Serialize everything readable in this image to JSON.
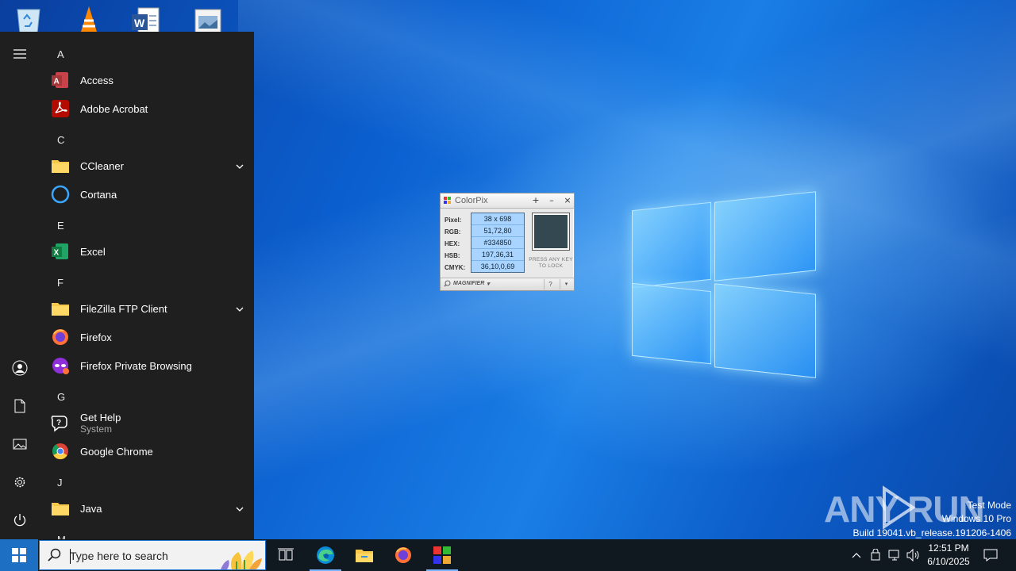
{
  "start_menu": {
    "sections": [
      {
        "letter": "A",
        "apps": [
          {
            "name": "Access"
          },
          {
            "name": "Adobe Acrobat"
          }
        ]
      },
      {
        "letter": "C",
        "apps": [
          {
            "name": "CCleaner"
          },
          {
            "name": "Cortana"
          }
        ]
      },
      {
        "letter": "E",
        "apps": [
          {
            "name": "Excel"
          }
        ]
      },
      {
        "letter": "F",
        "apps": [
          {
            "name": "FileZilla FTP Client"
          },
          {
            "name": "Firefox"
          },
          {
            "name": "Firefox Private Browsing"
          }
        ]
      },
      {
        "letter": "G",
        "apps": [
          {
            "name": "Get Help",
            "sub": "System"
          },
          {
            "name": "Google Chrome"
          }
        ]
      },
      {
        "letter": "J",
        "apps": [
          {
            "name": "Java"
          }
        ]
      },
      {
        "letter": "M"
      }
    ]
  },
  "colorpix": {
    "title": "ColorPix",
    "labels": {
      "pixel": "Pixel:",
      "rgb": "RGB:",
      "hex": "HEX:",
      "hsb": "HSB:",
      "cmyk": "CMYK:"
    },
    "values": {
      "pixel": "38 x 698",
      "rgb": "51,72,80",
      "hex": "#334850",
      "hsb": "197,36,31",
      "cmyk": "36,10,0,69"
    },
    "swatch_color": "#334850",
    "lock_hint": "PRESS ANY KEY TO LOCK",
    "magnifier_label": "MAGNIFIER",
    "help_label": "?"
  },
  "watermark": {
    "logo_text": "ANY RUN",
    "test_mode": "Test Mode",
    "edition": "Windows 10 Pro",
    "build": "Build 19041.vb_release.191206-1406"
  },
  "taskbar": {
    "search_placeholder": "Type here to search",
    "time": "12:51 PM",
    "date": "6/10/2025"
  },
  "colors": {
    "start_bg": "#1f1f1f",
    "taskbar_bg": "#101820",
    "accent": "#1d6fc3"
  }
}
